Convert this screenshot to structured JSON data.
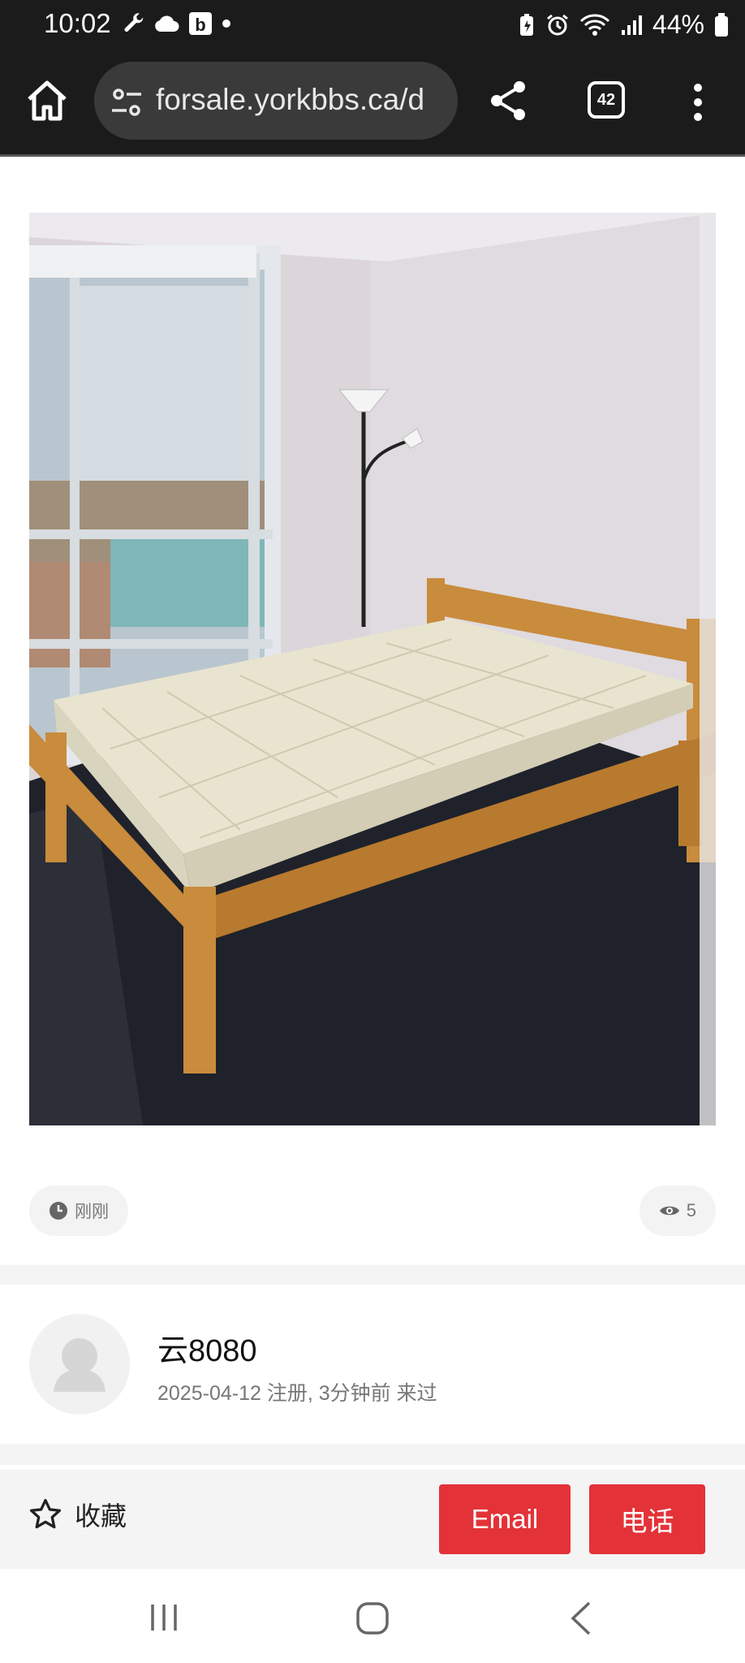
{
  "status_bar": {
    "time": "10:02",
    "battery": "44%"
  },
  "browser": {
    "url": "forsale.yorkbbs.ca/d",
    "tab_count": "42"
  },
  "listing": {
    "photo_alt": "Pine wood bed frame with mattress",
    "posted_time": "刚刚",
    "views": "5"
  },
  "seller": {
    "name": "云8080",
    "meta": "2025-04-12 注册, 3分钟前 来过"
  },
  "actions": {
    "favorite_label": "收藏",
    "email_label": "Email",
    "phone_label": "电话"
  },
  "colors": {
    "accent": "#e33338",
    "toolbar_bg": "#1b1b1b"
  }
}
